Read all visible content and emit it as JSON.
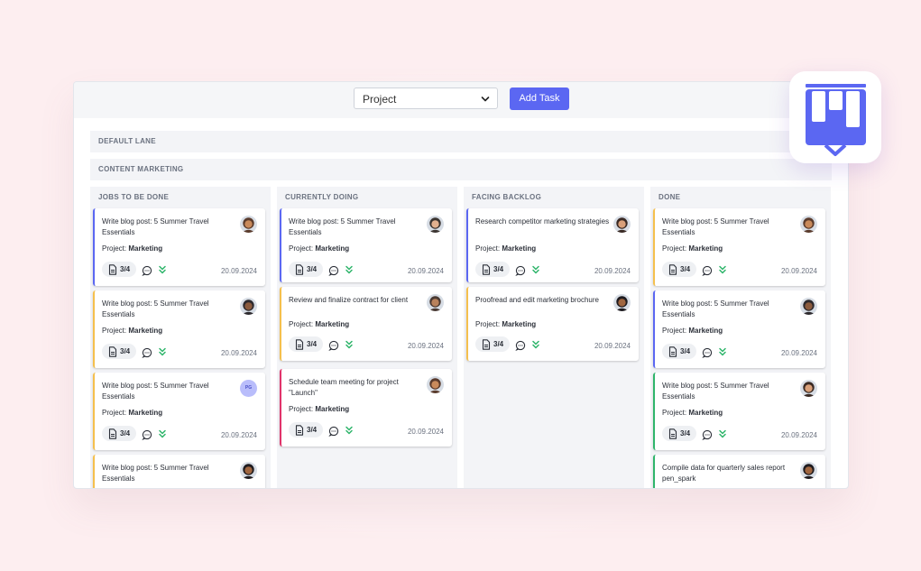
{
  "toolbar": {
    "project_select": "Project",
    "add_task_label": "Add Task"
  },
  "lanes": [
    {
      "label": "DEFAULT LANE"
    },
    {
      "label": "CONTENT MARKETING"
    }
  ],
  "columns": [
    {
      "title": "JOBS TO BE DONE",
      "cards": [
        {
          "title": "Write blog post: 5 Summer Travel Essentials",
          "project_label": "Project:",
          "project": "Marketing",
          "count": "3/4",
          "date": "20.09.2024",
          "accent": "#5b67f2",
          "avatar": "photo-avatar"
        },
        {
          "title": "Write blog post: 5 Summer Travel Essentials",
          "project_label": "Project:",
          "project": "Marketing",
          "count": "3/4",
          "date": "20.09.2024",
          "accent": "#f5c04d",
          "avatar": "photo-avatar"
        },
        {
          "title": "Write blog post: 5 Summer Travel Essentials",
          "project_label": "Project:",
          "project": "Marketing",
          "count": "3/4",
          "date": "20.09.2024",
          "accent": "#f5c04d",
          "avatar": "initials-avatar",
          "initials": "PG"
        },
        {
          "title": "Write blog post: 5 Summer Travel Essentials",
          "accent": "#f5c04d",
          "avatar": "photo-avatar"
        }
      ]
    },
    {
      "title": "CURRENTLY DOING",
      "cards": [
        {
          "title": "Write blog post: 5 Summer Travel Essentials",
          "project_label": "Project:",
          "project": "Marketing",
          "count": "3/4",
          "date": "20.09.2024",
          "accent": "#5b67f2",
          "avatar": "photo-avatar"
        },
        {
          "title": "Review and finalize contract for client",
          "project_label": "Project:",
          "project": "Marketing",
          "count": "3/4",
          "date": "20.09.2024",
          "accent": "#f5c04d",
          "avatar": "photo-avatar"
        },
        {
          "title": "Schedule team meeting for project \"Launch\"",
          "project_label": "Project:",
          "project": "Marketing",
          "count": "3/4",
          "date": "20.09.2024",
          "accent": "#e0336a",
          "avatar": "photo-avatar"
        }
      ]
    },
    {
      "title": "FACING BACKLOG",
      "cards": [
        {
          "title": "Research competitor marketing strategies",
          "project_label": "Project:",
          "project": "Marketing",
          "count": "3/4",
          "date": "20.09.2024",
          "accent": "#5b67f2",
          "avatar": "photo-avatar"
        },
        {
          "title": "Proofread and edit marketing brochure",
          "project_label": "Project:",
          "project": "Marketing",
          "count": "3/4",
          "date": "20.09.2024",
          "accent": "#f5c04d",
          "avatar": "photo-avatar"
        }
      ]
    },
    {
      "title": "DONE",
      "cards": [
        {
          "title": "Write blog post: 5 Summer Travel Essentials",
          "project_label": "Project:",
          "project": "Marketing",
          "count": "3/4",
          "date": "20.09.2024",
          "accent": "#f5c04d",
          "avatar": "photo-avatar"
        },
        {
          "title": "Write blog post: 5 Summer Travel Essentials",
          "project_label": "Project:",
          "project": "Marketing",
          "count": "3/4",
          "date": "20.09.2024",
          "accent": "#5b67f2",
          "avatar": "photo-avatar"
        },
        {
          "title": "Write blog post: 5 Summer Travel Essentials",
          "project_label": "Project:",
          "project": "Marketing",
          "count": "3/4",
          "date": "20.09.2024",
          "accent": "#2fb56b",
          "avatar": "photo-avatar"
        },
        {
          "title": "Compile data for quarterly sales report pen_spark",
          "accent": "#2fb56b",
          "avatar": "photo-avatar"
        }
      ]
    }
  ],
  "icons": {
    "document": "document-icon",
    "comment": "comment-icon",
    "priority": "double-chevron-down-icon",
    "dropdown": "chevron-down-icon",
    "logo": "kanban-board-logo"
  },
  "colors": {
    "primary": "#5b67f2",
    "yellow": "#f5c04d",
    "pink": "#e0336a",
    "green": "#2fb56b",
    "background": "#fdeef0"
  }
}
